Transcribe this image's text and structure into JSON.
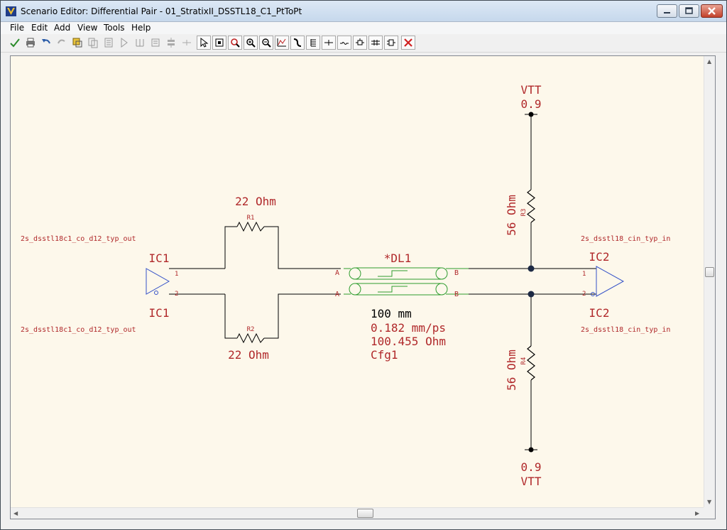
{
  "window": {
    "title": "Scenario Editor: Differential Pair - 01_StratixII_DSSTL18_C1_PtToPt"
  },
  "menu": {
    "items": [
      "File",
      "Edit",
      "Add",
      "View",
      "Tools",
      "Help"
    ]
  },
  "toolbar": {
    "buttons": [
      "check-icon",
      "print-icon",
      "undo-icon",
      "redo-icon",
      "select-all-icon",
      "copy-icon",
      "parts-icon",
      "buffer-icon",
      "termination-icon",
      "component-icon",
      "connector-icon",
      "pin-icon",
      "pointer-icon",
      "zoom-fit-icon",
      "zoom-area-icon",
      "zoom-in-icon",
      "zoom-out-icon",
      "waveform-icon",
      "probe-icon",
      "bus-icon",
      "tline-icon",
      "via-icon",
      "coupled-icon",
      "diffpair-icon",
      "delete-icon"
    ]
  },
  "colors": {
    "schematic": "#b0282a",
    "tline": "#2e9c2e",
    "buffer": "#3552c8",
    "wire": "#000000",
    "canvas": "#fdf8eb"
  },
  "schematic": {
    "top_vtt": {
      "label": "VTT",
      "value": "0.9"
    },
    "bottom_vtt": {
      "label": "VTT",
      "value": "0.9"
    },
    "r1": {
      "ref": "R1",
      "value": "22 Ohm"
    },
    "r2": {
      "ref": "R2",
      "value": "22 Ohm"
    },
    "r_top": {
      "ref": "R3",
      "value": "56 Ohm"
    },
    "r_bottom": {
      "ref": "R4",
      "value": "56 Ohm"
    },
    "ic1": {
      "ref_top": "IC1",
      "ref_bottom": "IC1",
      "model_top": "2s_dsstl18c1_co_d12_typ_out",
      "model_bottom": "2s_dsstl18c1_co_d12_typ_out",
      "pin1": "1",
      "pin2": "2"
    },
    "ic2": {
      "ref_top": "IC2",
      "ref_bottom": "IC2",
      "model_top": "2s_dsstl18_cin_typ_in",
      "model_bottom": "2s_dsstl18_cin_typ_in",
      "pin1": "1",
      "pin2": "2"
    },
    "tline": {
      "ref": "*DL1",
      "pin_a": "A",
      "pin_b": "B",
      "length": "100 mm",
      "velocity": "0.182 mm/ps",
      "impedance": "100.455 Ohm",
      "config": "Cfg1"
    }
  }
}
